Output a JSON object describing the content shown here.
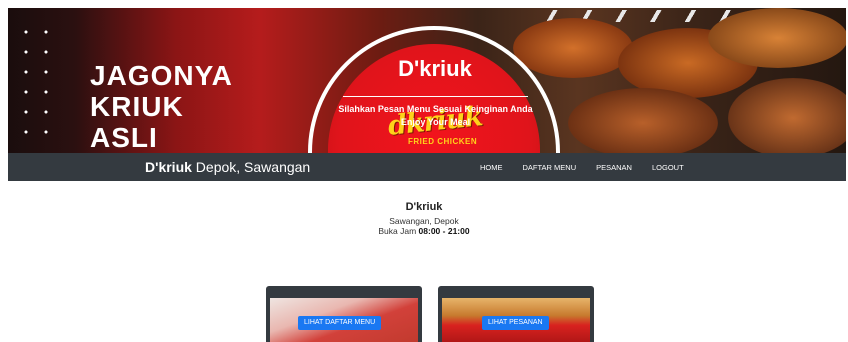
{
  "hero": {
    "slogan_lines": [
      "JAGONYA",
      "KRIUK",
      "ASLI"
    ],
    "title": "D'kriuk",
    "subtitle_line1": "Silahkan Pesan Menu Sesuai Keinginan Anda",
    "subtitle_line2": "Enjoy Your Meal",
    "logo_word": "dkriuk",
    "logo_sub": "FRIED CHICKEN"
  },
  "navbar": {
    "brand_bold": "D'kriuk",
    "brand_rest": " Depok, Sawangan",
    "links": [
      "HOME",
      "DAFTAR MENU",
      "PESANAN",
      "LOGOUT"
    ]
  },
  "info": {
    "name": "D'kriuk",
    "location": "Sawangan, Depok",
    "hours_prefix": "Buka Jam ",
    "hours": "08:00 - 21:00"
  },
  "cards": [
    {
      "button": "LIHAT DAFTAR MENU"
    },
    {
      "button": "LIHAT PESANAN"
    }
  ],
  "colors": {
    "navbar": "#343a40",
    "button": "#1a78f2",
    "logo_red": "#e0141b",
    "logo_yellow": "#ffd21a"
  }
}
